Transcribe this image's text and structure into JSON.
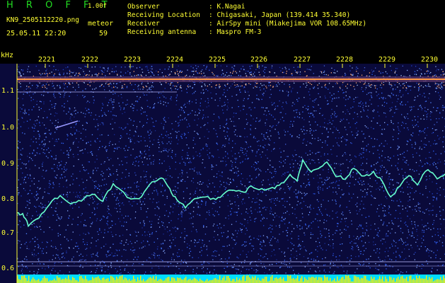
{
  "header": {
    "title": "H R O F F T",
    "version": "1.00f",
    "filename": "KN9_2505112220.png",
    "datetime": "25.05.11 22:20",
    "meteor_label": "meteor",
    "meteor_count": "59"
  },
  "meta": {
    "observer_label": "Observer",
    "observer_value": ": K.Nagai",
    "location_label": "Receiving Location",
    "location_value": ": Chigasaki, Japan (139.414 35.340)",
    "receiver_label": "Receiver",
    "receiver_value": ": AirSpy mini (Miakejima VOR 108.65MHz)",
    "antenna_label": "Receiving antenna",
    "antenna_value": ": Maspro FM-3"
  },
  "axis": {
    "unit": "kHz",
    "y_ticks": [
      "1.1",
      "1.0",
      "0.9",
      "0.8",
      "0.7",
      "0.6"
    ],
    "x_ticks": [
      "2221",
      "2222",
      "2223",
      "2224",
      "2225",
      "2226",
      "2227",
      "2228",
      "2229",
      "2230"
    ]
  },
  "colors": {
    "background": "#0a0a3a",
    "noise": "#3355ff",
    "doppler_trace": "#66ffcc",
    "carrier": "#ff9944",
    "power_bar": "#ffee00",
    "power_base": "#00ddff"
  }
}
